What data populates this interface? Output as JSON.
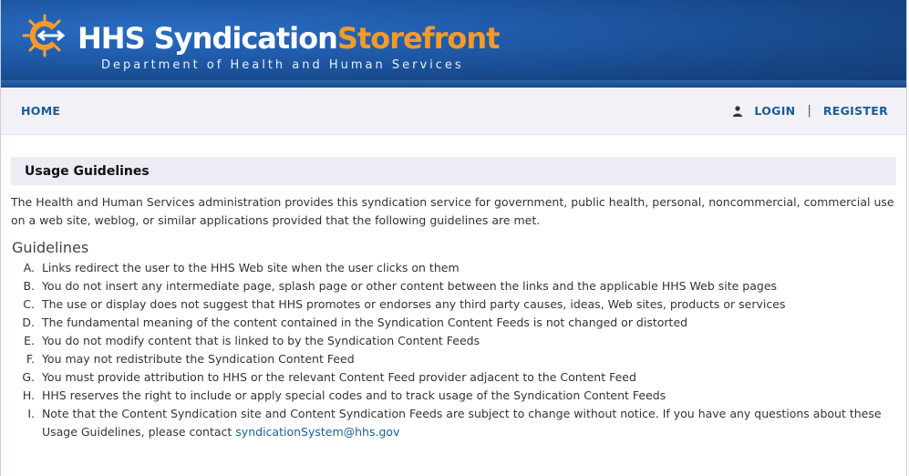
{
  "header": {
    "title_part1": "HHS",
    "title_part2": "Syndication",
    "title_part3": "Storefront",
    "subtitle": "Department of Health and Human Services",
    "icon": "logo-sun-arrows",
    "colors": {
      "banner": "#1f5aa8",
      "accent": "#f59a2a"
    }
  },
  "nav": {
    "home": "HOME",
    "login": "LOGIN",
    "separator": "|",
    "register": "REGISTER",
    "user_icon": "user-icon"
  },
  "page": {
    "section_title": "Usage Guidelines",
    "intro": "The Health and Human Services administration provides this syndication service for government, public health, personal, noncommercial, commercial use on a web site, weblog, or similar applications provided that the following guidelines are met.",
    "guidelines_title": "Guidelines",
    "items": [
      {
        "marker": "A.",
        "text": "Links redirect the user to the HHS Web site when the user clicks on them"
      },
      {
        "marker": "B.",
        "text": "You do not insert any intermediate page, splash page or other content between the links and the applicable HHS Web site pages"
      },
      {
        "marker": "C.",
        "text": "The use or display does not suggest that HHS promotes or endorses any third party causes, ideas, Web sites, products or services"
      },
      {
        "marker": "D.",
        "text": "The fundamental meaning of the content contained in the Syndication Content Feeds is not changed or distorted"
      },
      {
        "marker": "E.",
        "text": "You do not modify content that is linked to by the Syndication Content Feeds"
      },
      {
        "marker": "F.",
        "text": "You may not redistribute the Syndication Content Feed"
      },
      {
        "marker": "G.",
        "text": "You must provide attribution to HHS or the relevant Content Feed provider adjacent to the Content Feed"
      },
      {
        "marker": "H.",
        "text": "HHS reserves the right to include or apply special codes and to track usage of the Syndication Content Feeds"
      }
    ],
    "last_item": {
      "marker": "I.",
      "text": "Note that the Content Syndication site and Content Syndication Feeds are subject to change without notice. If you have any questions about these Usage Guidelines, please contact ",
      "email": "syndicationSystem@hhs.gov"
    }
  }
}
